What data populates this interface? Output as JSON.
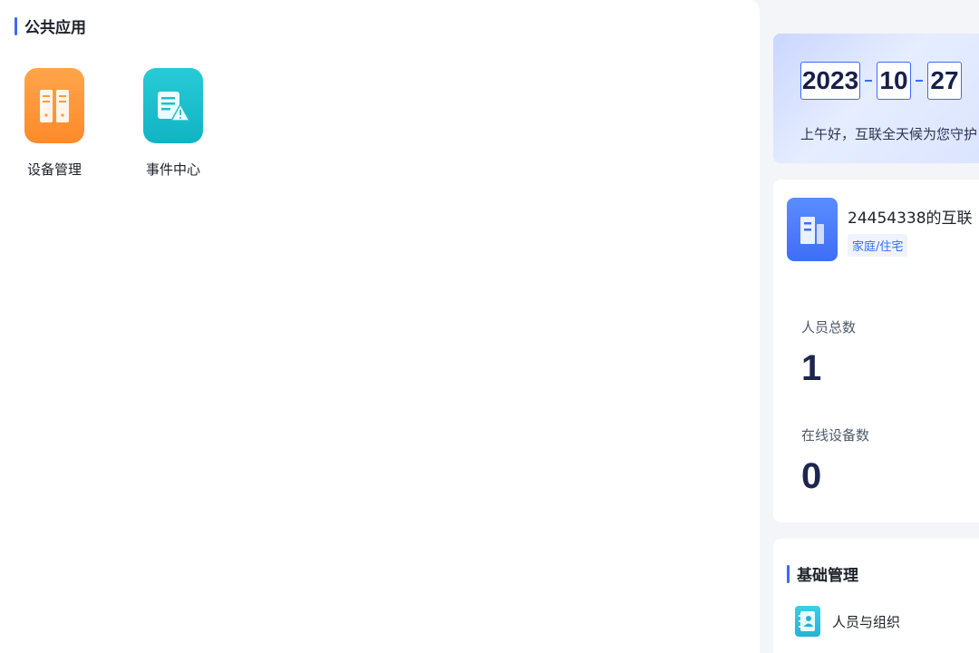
{
  "public_apps": {
    "title": "公共应用",
    "items": [
      {
        "label": "设备管理",
        "icon": "device-cabinet-icon",
        "color": "#ff9a3c"
      },
      {
        "label": "事件中心",
        "icon": "event-alert-icon",
        "color": "#1fbfcf"
      }
    ]
  },
  "date_card": {
    "year": "2023",
    "month": "10",
    "day": "27",
    "greeting": "上午好，互联全天候为您守护"
  },
  "org_card": {
    "name": "24454338的互联",
    "tag": "家庭/住宅",
    "icon": "building-icon",
    "stats": [
      {
        "label": "人员总数",
        "value": "1"
      },
      {
        "label": "在线设备数",
        "value": "0"
      }
    ]
  },
  "basic_management": {
    "title": "基础管理",
    "items": [
      {
        "label": "人员与组织",
        "icon": "contacts-book-icon"
      }
    ]
  },
  "colors": {
    "accent": "#3a6cf4",
    "heading": "#1d2129",
    "stat_value": "#1e2650"
  }
}
